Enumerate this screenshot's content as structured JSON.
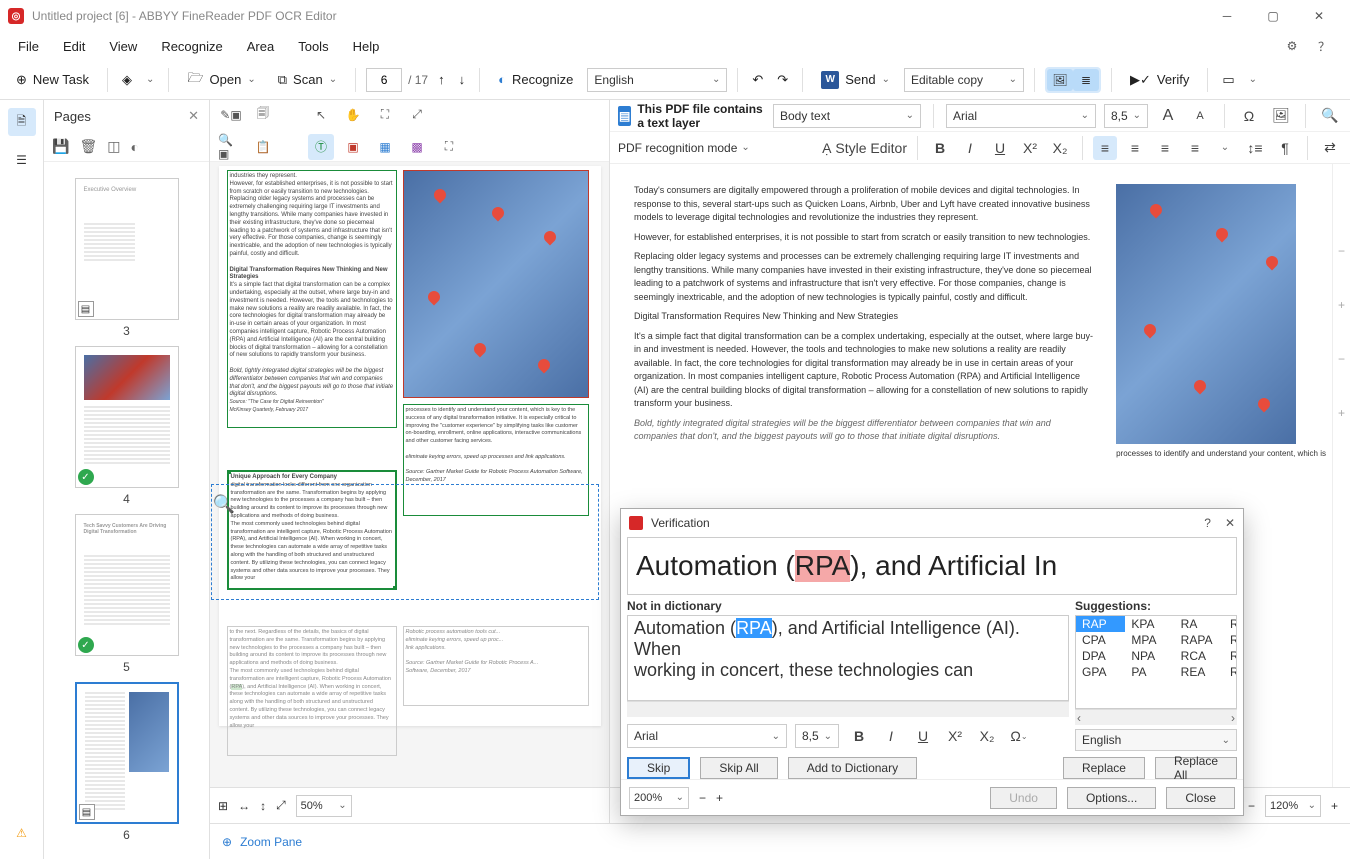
{
  "titlebar": {
    "title": "Untitled project [6] - ABBYY FineReader PDF OCR Editor"
  },
  "menubar": {
    "items": [
      "File",
      "Edit",
      "View",
      "Recognize",
      "Area",
      "Tools",
      "Help"
    ]
  },
  "toolbar": {
    "new_task": "New Task",
    "open": "Open",
    "scan": "Scan",
    "page_current": "6",
    "page_total": "/ 17",
    "recognize": "Recognize",
    "language": "English",
    "send": "Send",
    "save_mode": "Editable copy",
    "verify": "Verify"
  },
  "pages_panel": {
    "title": "Pages",
    "thumbs": [
      {
        "num": "3",
        "badge": "doc"
      },
      {
        "num": "4",
        "badge": "ok"
      },
      {
        "num": "5",
        "badge": "ok"
      },
      {
        "num": "6",
        "badge": "doc",
        "selected": true
      }
    ]
  },
  "notice": {
    "pdf_text_layer": "This PDF file contains a text layer",
    "reco_mode": "PDF recognition mode"
  },
  "text_format": {
    "style": "Body text",
    "style_editor": "Style Editor",
    "font": "Arial",
    "size": "8,5"
  },
  "image_zoom": "50%",
  "zoom_pane": "Zoom Pane",
  "text_zoom": "120%",
  "rendered_text": {
    "p1": "Today's consumers are digitally empowered through a proliferation of mobile devices and digital technologies. In response to this, several start-ups such as Quicken Loans, Airbnb, Uber and Lyft have created innovative business models to leverage digital technologies and revolutionize the industries they represent.",
    "p2": "However, for established enterprises, it is not possible to start from scratch or easily transition to new technologies.",
    "p3": "Replacing older legacy systems and processes can be extremely challenging requiring large IT investments and lengthy transitions. While many companies have invested in their existing infrastructure, they've done so piecemeal leading to a patchwork of systems and infrastructure that isn't very effective. For those companies, change is seemingly inextricable, and the adoption of new technologies is typically painful, costly and difficult.",
    "h1": "Digital Transformation Requires New Thinking and New Strategies",
    "p4": "It's a simple fact that digital transformation can be a complex undertaking, especially at the outset, where large buy-in and investment is needed. However, the tools and technologies to make new solutions a reality are readily available. In fact, the core technologies for digital transformation may already be in use in certain areas of your organization. In most companies intelligent capture, Robotic Process Automation (RPA) and Artificial Intelligence (AI) are the central building blocks of digital transformation – allowing for a constellation of new solutions to rapidly transform your business.",
    "quote": "Bold, tightly integrated digital strategies will be the biggest differentiator between companies that win and companies that don't, and the biggest payouts will go to those that initiate digital disruptions.",
    "caption": "processes to identify and understand your content, which is"
  },
  "verification": {
    "title": "Verification",
    "snippet_pre": "Automation (",
    "snippet_err": "RPA",
    "snippet_post": "), and Artificial In",
    "not_in_dict": "Not in dictionary",
    "text_pre": "Automation (",
    "text_sel": "RPA",
    "text_post1": "), and Artificial Intelligence (AI). When",
    "text_line2": "working in concert, these technologies can",
    "font": "Arial",
    "size": "8,5",
    "skip": "Skip",
    "skip_all": "Skip All",
    "add_dict": "Add to Dictionary",
    "suggestions_label": "Suggestions:",
    "suggestions": [
      [
        "RAP",
        "KPA",
        "RA",
        "R"
      ],
      [
        "CPA",
        "MPA",
        "RAPA",
        "R"
      ],
      [
        "DPA",
        "NPA",
        "RCA",
        "R"
      ],
      [
        "GPA",
        "PA",
        "REA",
        "R"
      ]
    ],
    "language": "English",
    "replace": "Replace",
    "replace_all": "Replace All",
    "zoom": "200%",
    "undo": "Undo",
    "options": "Options...",
    "close": "Close"
  }
}
